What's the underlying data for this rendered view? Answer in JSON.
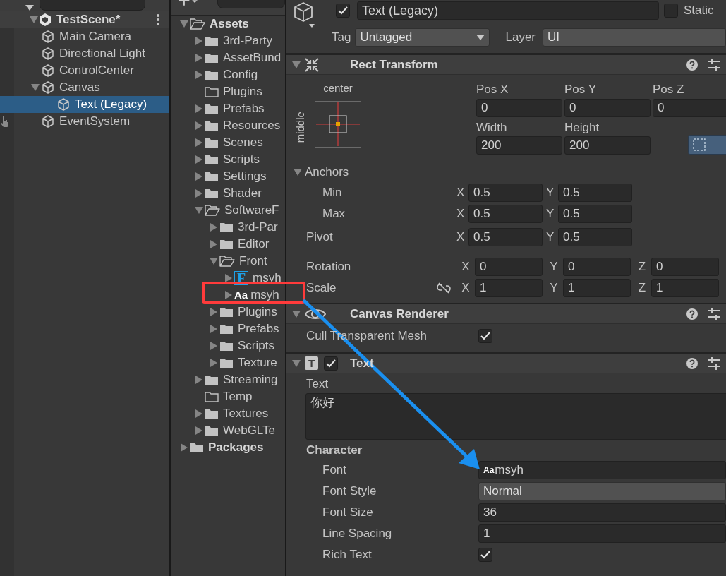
{
  "hierarchy": {
    "scene": {
      "label": "TestScene*",
      "expanded": true
    },
    "items": [
      {
        "label": "Main Camera",
        "selected": false
      },
      {
        "label": "Directional Light",
        "selected": false
      },
      {
        "label": "ControlCenter",
        "selected": false
      },
      {
        "label": "Canvas",
        "selected": false,
        "expanded": true,
        "children": [
          {
            "label": "Text (Legacy)",
            "selected": true
          }
        ]
      },
      {
        "label": "EventSystem",
        "selected": false
      }
    ]
  },
  "project": {
    "items": [
      {
        "kind": "folder",
        "label": "Assets",
        "expanded": true,
        "bold": true,
        "children": [
          {
            "kind": "folder",
            "label": "3rd-Party",
            "expanded": false
          },
          {
            "kind": "folder",
            "label": "AssetBund",
            "expanded": false
          },
          {
            "kind": "folder",
            "label": "Config",
            "expanded": false
          },
          {
            "kind": "empty-folder",
            "label": "Plugins"
          },
          {
            "kind": "folder",
            "label": "Prefabs",
            "expanded": false
          },
          {
            "kind": "folder",
            "label": "Resources",
            "expanded": false
          },
          {
            "kind": "folder",
            "label": "Scenes",
            "expanded": false
          },
          {
            "kind": "folder",
            "label": "Scripts",
            "expanded": false
          },
          {
            "kind": "folder",
            "label": "Settings",
            "expanded": false
          },
          {
            "kind": "folder",
            "label": "Shader",
            "expanded": false
          },
          {
            "kind": "folder",
            "label": "SoftwareF",
            "expanded": true,
            "children": [
              {
                "kind": "folder",
                "label": "3rd-Par",
                "expanded": false
              },
              {
                "kind": "folder",
                "label": "Editor",
                "expanded": false
              },
              {
                "kind": "folder",
                "label": "Front",
                "expanded": true,
                "children": [
                  {
                    "kind": "font-asset",
                    "icon_text": "F",
                    "label": "msyh",
                    "expanded": false
                  },
                  {
                    "kind": "font",
                    "icon_text": "Aa",
                    "label": "msyh",
                    "expanded": false
                  }
                ]
              },
              {
                "kind": "folder",
                "label": "Plugins",
                "expanded": false
              },
              {
                "kind": "folder",
                "label": "Prefabs",
                "expanded": false
              },
              {
                "kind": "folder",
                "label": "Scripts",
                "expanded": false
              },
              {
                "kind": "folder",
                "label": "Texture",
                "expanded": false
              }
            ]
          },
          {
            "kind": "folder",
            "label": "Streaming",
            "expanded": false
          },
          {
            "kind": "empty-folder",
            "label": "Temp"
          },
          {
            "kind": "folder",
            "label": "Textures",
            "expanded": false
          },
          {
            "kind": "folder",
            "label": "WebGLTe",
            "expanded": false
          }
        ]
      },
      {
        "kind": "folder",
        "label": "Packages",
        "expanded": false,
        "bold": true
      }
    ]
  },
  "inspector": {
    "active": true,
    "name": "Text (Legacy)",
    "static": {
      "label": "Static",
      "checked": false
    },
    "tag": {
      "label": "Tag",
      "value": "Untagged"
    },
    "layer": {
      "label": "Layer",
      "value": "UI"
    },
    "components": [
      {
        "kind": "rect-transform",
        "title": "Rect Transform",
        "expanded": true,
        "anchor_preset": {
          "horizontal": "center",
          "vertical": "middle"
        },
        "position": [
          {
            "label": "Pos X",
            "value": "0"
          },
          {
            "label": "Pos Y",
            "value": "0"
          },
          {
            "label": "Pos Z",
            "value": "0"
          }
        ],
        "size": [
          {
            "label": "Width",
            "value": "200"
          },
          {
            "label": "Height",
            "value": "200"
          }
        ],
        "anchors": {
          "label": "Anchors",
          "expanded": true,
          "rows": [
            {
              "label": "Min",
              "fields": [
                {
                  "axis": "X",
                  "value": "0.5"
                },
                {
                  "axis": "Y",
                  "value": "0.5"
                }
              ]
            },
            {
              "label": "Max",
              "fields": [
                {
                  "axis": "X",
                  "value": "0.5"
                },
                {
                  "axis": "Y",
                  "value": "0.5"
                }
              ]
            }
          ]
        },
        "pivot": {
          "label": "Pivot",
          "fields": [
            {
              "axis": "X",
              "value": "0.5"
            },
            {
              "axis": "Y",
              "value": "0.5"
            }
          ]
        },
        "rotation": {
          "label": "Rotation",
          "fields": [
            {
              "axis": "X",
              "value": "0"
            },
            {
              "axis": "Y",
              "value": "0"
            },
            {
              "axis": "Z",
              "value": "0"
            }
          ]
        },
        "scale": {
          "label": "Scale",
          "linked": false,
          "fields": [
            {
              "axis": "X",
              "value": "1"
            },
            {
              "axis": "Y",
              "value": "1"
            },
            {
              "axis": "Z",
              "value": "1"
            }
          ]
        }
      },
      {
        "kind": "canvas-renderer",
        "title": "Canvas Renderer",
        "expanded": true,
        "properties": [
          {
            "kind": "checkbox",
            "label": "Cull Transparent Mesh",
            "checked": true
          }
        ]
      },
      {
        "kind": "text",
        "title": "Text",
        "icon_text": "T",
        "expanded": true,
        "enabled": true,
        "text_label": "Text",
        "text_value": "你好",
        "section": "Character",
        "properties": [
          {
            "kind": "object",
            "label": "Font",
            "icon_text": "Aa",
            "value": "msyh"
          },
          {
            "kind": "dropdown",
            "label": "Font Style",
            "value": "Normal"
          },
          {
            "kind": "field",
            "label": "Font Size",
            "value": "36"
          },
          {
            "kind": "field",
            "label": "Line Spacing",
            "value": "1"
          },
          {
            "kind": "checkbox",
            "label": "Rich Text",
            "checked": true
          }
        ]
      }
    ]
  }
}
